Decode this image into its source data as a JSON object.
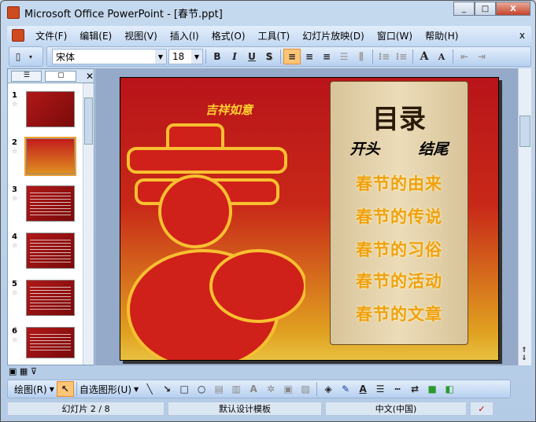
{
  "window": {
    "title": "Microsoft Office PowerPoint - [春节.ppt]",
    "min": "_",
    "max": "□",
    "close": "X"
  },
  "menu": [
    "文件(F)",
    "编辑(E)",
    "视图(V)",
    "插入(I)",
    "格式(O)",
    "工具(T)",
    "幻灯片放映(D)",
    "窗口(W)",
    "帮助(H)"
  ],
  "menu_close": "x",
  "format": {
    "font": "宋体",
    "size": "18",
    "bold": "B",
    "italic": "I",
    "underline": "U",
    "shadow": "S",
    "grow": "A",
    "shrink": "A"
  },
  "thumbs": [
    {
      "n": "1"
    },
    {
      "n": "2"
    },
    {
      "n": "3"
    },
    {
      "n": "4"
    },
    {
      "n": "5"
    },
    {
      "n": "6"
    }
  ],
  "star": "☆",
  "slide": {
    "logo": "吉祥如意",
    "title": "目录",
    "start": "开头",
    "end": "结尾",
    "items": [
      "春节的由来",
      "春节的传说",
      "春节的习俗",
      "春节的活动",
      "春节的文章"
    ]
  },
  "draw": {
    "draw_menu": "绘图(R)",
    "autoshapes": "自选图形(U)"
  },
  "status": {
    "slide": "幻灯片 2 / 8",
    "template": "默认设计模板",
    "lang": "中文(中国)"
  }
}
